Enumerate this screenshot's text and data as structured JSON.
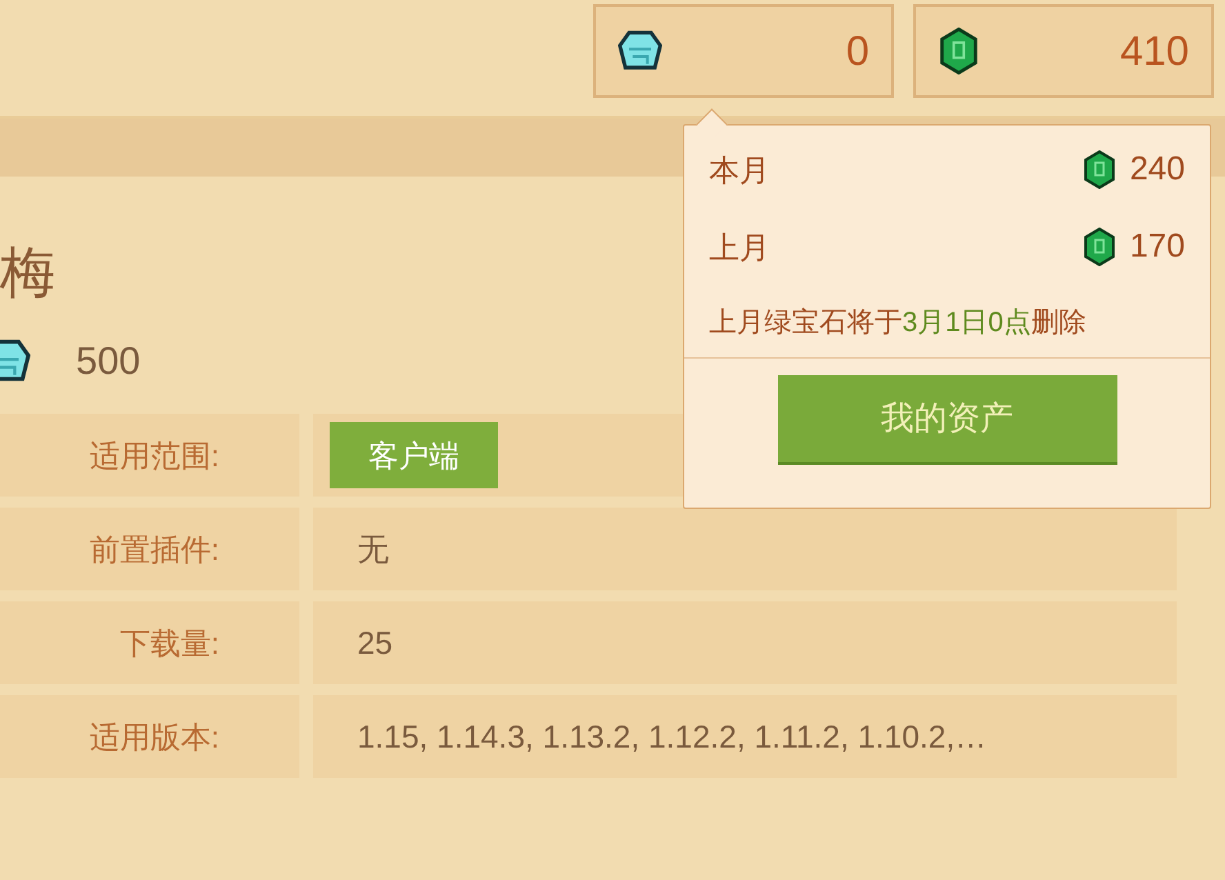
{
  "currencies": [
    {
      "kind": "diamond",
      "amount": "0"
    },
    {
      "kind": "emerald",
      "amount": "410"
    }
  ],
  "popup": {
    "rows": [
      {
        "label": "本月",
        "amount": "240"
      },
      {
        "label": "上月",
        "amount": "170"
      }
    ],
    "notice": [
      {
        "text": "上月绿宝石将于",
        "kind": "plain"
      },
      {
        "text": "3月1日0点",
        "kind": "highlight"
      },
      {
        "text": "删除",
        "kind": "plain"
      }
    ],
    "button": "我的资产"
  },
  "item": {
    "title": "梅",
    "price": "500"
  },
  "details": [
    {
      "label": "适用范围:",
      "value": "客户端",
      "kind": "tag"
    },
    {
      "label": "前置插件:",
      "value": "无",
      "kind": "text"
    },
    {
      "label": "下载量:",
      "value": "25",
      "kind": "text"
    },
    {
      "label": "适用版本:",
      "value": "1.15, 1.14.3, 1.13.2, 1.12.2, 1.11.2, 1.10.2,…",
      "kind": "text"
    }
  ]
}
